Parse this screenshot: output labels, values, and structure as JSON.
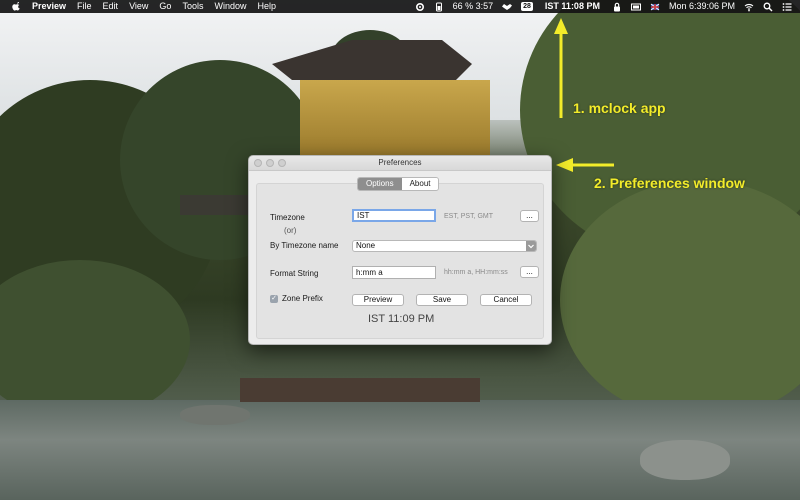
{
  "menubar": {
    "app_name": "Preview",
    "menus": [
      "File",
      "Edit",
      "View",
      "Go",
      "Tools",
      "Window",
      "Help"
    ],
    "battery_text": "66 % 3:57",
    "calendar_badge": "28",
    "clock_app_text": "IST 11:08 PM",
    "datetime": "Mon 6:39:06 PM"
  },
  "annotations": {
    "label_1": "1. mclock app",
    "label_2": "2. Preferences window",
    "color": "#f3ec2a"
  },
  "window": {
    "title": "Preferences",
    "tabs": [
      {
        "label": "Options",
        "active": true
      },
      {
        "label": "About",
        "active": false
      }
    ],
    "timezone": {
      "label": "Timezone",
      "value": "IST",
      "hint": "EST, PST, GMT",
      "more_button": "..."
    },
    "or_label": "(or)",
    "by_timezone_name": {
      "label": "By Timezone name",
      "selected": "None"
    },
    "format_string": {
      "label": "Format String",
      "value": "h:mm a",
      "hint": "hh:mm a, HH:mm:ss",
      "more_button": "..."
    },
    "zone_prefix": {
      "label": "Zone Prefix",
      "checked": true
    },
    "buttons": {
      "preview": "Preview",
      "save": "Save",
      "cancel": "Cancel"
    },
    "preview_text": "IST  11:09 PM"
  }
}
